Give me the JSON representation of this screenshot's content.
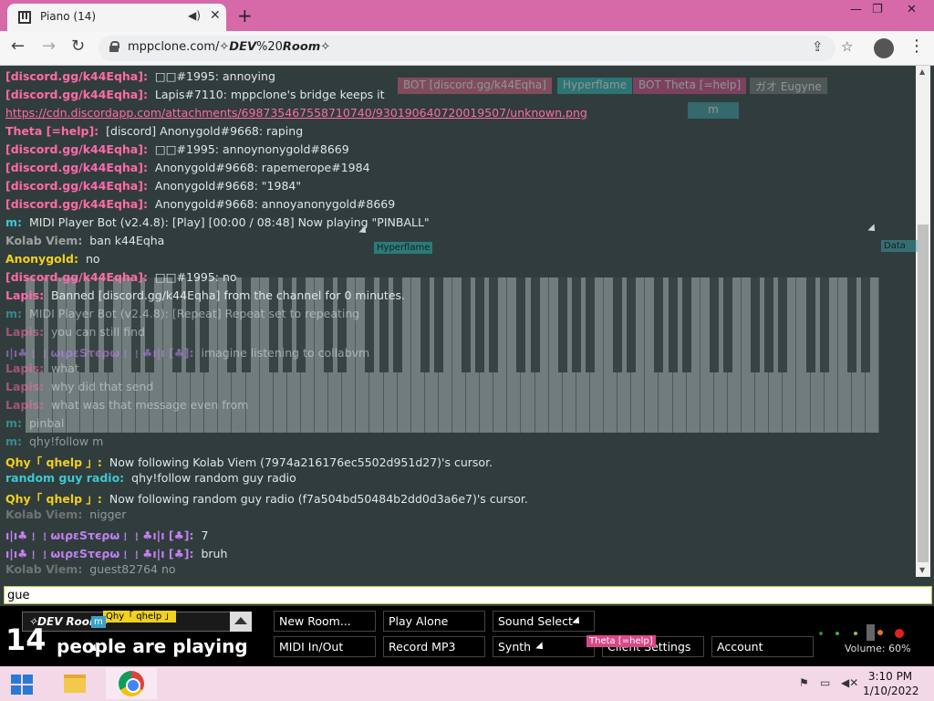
{
  "browser": {
    "tab_title": "Piano (14)",
    "tab_audio_icon": "speaker-icon",
    "url": "mppclone.com/✧𝘿𝙀𝙑%20𝙍𝙤𝙤𝙢✧"
  },
  "ghost_names": [
    {
      "label": "BOT [discord.gg/k44Eqha]",
      "color": "#e06080"
    },
    {
      "label": "Hyperflame",
      "color": "#2ab8b8"
    },
    {
      "label": "BOT Theta [=help]",
      "color": "#d84888"
    },
    {
      "label": "ガオ Eugyne",
      "color": "#777777"
    },
    {
      "label": "m",
      "color": "#3aa0a8"
    }
  ],
  "chat": [
    {
      "name": "[discord.gg/k44Eqha]:",
      "text": "□□#1995: annoying",
      "color": "#ff6aa8",
      "faded": false
    },
    {
      "name": "[discord.gg/k44Eqha]:",
      "text": "Lapis#7110: mppclone's bridge keeps it",
      "color": "#ff6aa8",
      "faded": false
    },
    {
      "name": "",
      "text": "https://cdn.discordapp.com/attachments/698735467558710740/930190640720019507/unknown.png",
      "color": "#ff6aa8",
      "faded": false,
      "link": true
    },
    {
      "name": "Theta [=help]:",
      "text": "[discord] Anonygold#9668: raping",
      "color": "#ff6aa8",
      "faded": false
    },
    {
      "name": "[discord.gg/k44Eqha]:",
      "text": "□□#1995: annoynonygold#8669",
      "color": "#ff6aa8",
      "faded": false
    },
    {
      "name": "[discord.gg/k44Eqha]:",
      "text": "Anonygold#9668: rapemerope#1984",
      "color": "#ff6aa8",
      "faded": false
    },
    {
      "name": "[discord.gg/k44Eqha]:",
      "text": "Anonygold#9668: \"1984\"",
      "color": "#ff6aa8",
      "faded": false
    },
    {
      "name": "[discord.gg/k44Eqha]:",
      "text": "Anonygold#9668: annoyanonygold#8669",
      "color": "#ff6aa8",
      "faded": false
    },
    {
      "name": "m:",
      "text": "MIDI Player Bot (v2.4.8): [Play] [00:00 / 08:48] Now playing \"PINBALL\"",
      "color": "#3dc8d0",
      "faded": false
    },
    {
      "name": "Kolab Viem:",
      "text": "ban k44Eqha",
      "color": "#a0a0a0",
      "faded": false
    },
    {
      "name": "Anonygold:",
      "text": "no",
      "color": "#f0d020",
      "faded": false
    },
    {
      "name": "[discord.gg/k44Eqha]:",
      "text": "□□#1995: no",
      "color": "#ff6aa8",
      "faded": false
    },
    {
      "name": "Lapis:",
      "text": "Banned [discord.gg/k44Eqha] from the channel for 0 minutes.",
      "color": "#ff6aa8",
      "faded": false
    },
    {
      "name": "m:",
      "text": "MIDI Player Bot (v2.4.8): [Repeat] Repeat set to repeating",
      "color": "#3dc8d0",
      "faded": true
    },
    {
      "name": "Lapis:",
      "text": "you can still find",
      "color": "#ff6aa8",
      "faded": true
    },
    {
      "name": "ı|ı♣﹗﹗ωιρεЅτєρω﹗﹗♣ı|ı [♣]:",
      "text": "imagine listening to collabvm",
      "color": "#c080f0",
      "faded": true
    },
    {
      "name": "Lapis:",
      "text": "what",
      "color": "#ff6aa8",
      "faded": true
    },
    {
      "name": "Lapis:",
      "text": "why did that send",
      "color": "#ff6aa8",
      "faded": true
    },
    {
      "name": "Lapis:",
      "text": "what was that message even from",
      "color": "#ff6aa8",
      "faded": true
    },
    {
      "name": "m:",
      "text": "pinbal",
      "color": "#3dc8d0",
      "faded": true
    },
    {
      "name": "m:",
      "text": "qhy!follow m",
      "color": "#3dc8d0",
      "faded": true
    },
    {
      "name": "Qhy「 qhelp 」:",
      "text": "Now following Kolab Viem (7974a216176ec5502d951d27)'s cursor.",
      "color": "#f0d020",
      "faded": false
    },
    {
      "name": "random guy radio:",
      "text": "qhy!follow random guy radio",
      "color": "#3dc8d0",
      "faded": false
    },
    {
      "name": "Qhy「 qhelp 」:",
      "text": "Now following random guy radio (f7a504bd50484b2dd0d3a6e7)'s cursor.",
      "color": "#f0d020",
      "faded": false
    },
    {
      "name": "Kolab Viem:",
      "text": "nigger",
      "color": "#a0a0a0",
      "faded": true
    },
    {
      "name": "ı|ı♣﹗﹗ωιρεЅτєρω﹗﹗♣ı|ı [♣]:",
      "text": "7",
      "color": "#c080f0",
      "faded": false
    },
    {
      "name": "ı|ı♣﹗﹗ωιρεЅτєρω﹗﹗♣ı|ı [♣]:",
      "text": "bruh",
      "color": "#c080f0",
      "faded": false
    },
    {
      "name": "Kolab Viem:",
      "text": "guest82764 no",
      "color": "#a0a0a0",
      "faded": true
    }
  ],
  "chat_input": {
    "value": "gue"
  },
  "controls": {
    "room_name": "✧𝘿𝙀𝙑 𝙍𝙤𝙤𝙢✧",
    "people_count": "14",
    "people_text": "people are playing",
    "buttons_row1": [
      "New Room...",
      "Play Alone",
      "Sound Select"
    ],
    "buttons_row2": [
      "MIDI In/Out",
      "Record MP3",
      "Synth",
      "Client Settings",
      "Account"
    ],
    "volume": "Volume: 60%"
  },
  "cursors": [
    {
      "label": "Qhy「 qhelp 」",
      "color": "#f0d020",
      "text_color": "#000000"
    },
    {
      "label": "m",
      "color": "#3aa0c8",
      "text_color": "#ffffff"
    },
    {
      "label": "Theta [=help]",
      "color": "#d84888",
      "text_color": "#ffffff"
    },
    {
      "label": "Hyperflame",
      "color": "#2ab8b8",
      "text_color": "#ffffff"
    },
    {
      "label": "Data",
      "color": "#3aa0a8",
      "text_color": "#ffffff"
    }
  ],
  "taskbar": {
    "time": "3:10 PM",
    "date": "1/10/2022"
  }
}
